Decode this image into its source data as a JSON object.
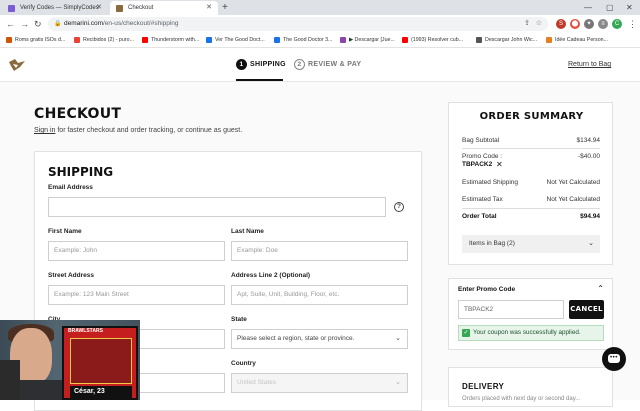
{
  "browser": {
    "tabs": [
      {
        "title": "Verify Codes — SimplyCodes",
        "color": "#7b5cd6"
      },
      {
        "title": "Checkout",
        "color": "#8b6a3e"
      }
    ],
    "url_host": "demarini.com",
    "url_path": "/en-us/checkout/#shipping",
    "bookmarks": [
      {
        "label": "Roms gratis ISOs d...",
        "color": "#d35400"
      },
      {
        "label": "Recibidos (2) - puro...",
        "color": "#ea4335"
      },
      {
        "label": "Thunderstorm with...",
        "color": "#ff0000"
      },
      {
        "label": "Ver The Good Doct...",
        "color": "#1a73e8"
      },
      {
        "label": "The Good Doctor 3...",
        "color": "#1a73e8"
      },
      {
        "label": "▶ Descargar [Jue...",
        "color": "#8e44ad"
      },
      {
        "label": "(1993) Resolver cub...",
        "color": "#ff0000"
      },
      {
        "label": "Descargar John Wic...",
        "color": "#555555"
      },
      {
        "label": "Idée Cadeau Person...",
        "color": "#e67e22"
      }
    ]
  },
  "header": {
    "steps": [
      {
        "number": "1",
        "label": "SHIPPING"
      },
      {
        "number": "2",
        "label": "REVIEW & PAY"
      }
    ],
    "return_link": "Return to Bag"
  },
  "checkout": {
    "title": "CHECKOUT",
    "signin_link": "Sign in",
    "signin_rest": " for faster checkout and order tracking, or continue as guest."
  },
  "shipping": {
    "title": "SHIPPING",
    "email_label": "Email Address",
    "email_value": "",
    "help_icon": "?",
    "first_name_label": "First Name",
    "first_name_placeholder": "Example: John",
    "last_name_label": "Last Name",
    "last_name_placeholder": "Example: Doe",
    "street_label": "Street Address",
    "street_placeholder": "Example: 123 Main Street",
    "address2_label": "Address Line 2 (Optional)",
    "address2_placeholder": "Apt, Suite, Unit, Building, Floor, etc.",
    "city_label": "City",
    "state_label": "State",
    "state_value": "Please select a region, state or province.",
    "country_label": "Country",
    "country_value": "United States"
  },
  "summary": {
    "title": "ORDER SUMMARY",
    "bag_subtotal_label": "Bag Subtotal",
    "bag_subtotal_value": "$134.94",
    "promo_label": "Promo Code :",
    "promo_value": "-$40.00",
    "promo_code": "TBPACK2",
    "promo_remove": "✕",
    "shipping_label": "Estimated Shipping",
    "shipping_value": "Not Yet Calculated",
    "tax_label": "Estimated Tax",
    "tax_value": "Not Yet Calculated",
    "total_label": "Order Total",
    "total_value": "$94.94",
    "items_in_bag": "Items in Bag (2)"
  },
  "promo": {
    "heading": "Enter Promo Code",
    "input_value": "TBPACK2",
    "cancel_label": "CANCEL",
    "success_message": "Your coupon was successfully applied."
  },
  "delivery": {
    "title": "DELIVERY",
    "subtitle": "Orders placed with next day or second day..."
  },
  "webcam": {
    "card_tag": "BRAWLSTARS",
    "card_name": "César, 23"
  }
}
